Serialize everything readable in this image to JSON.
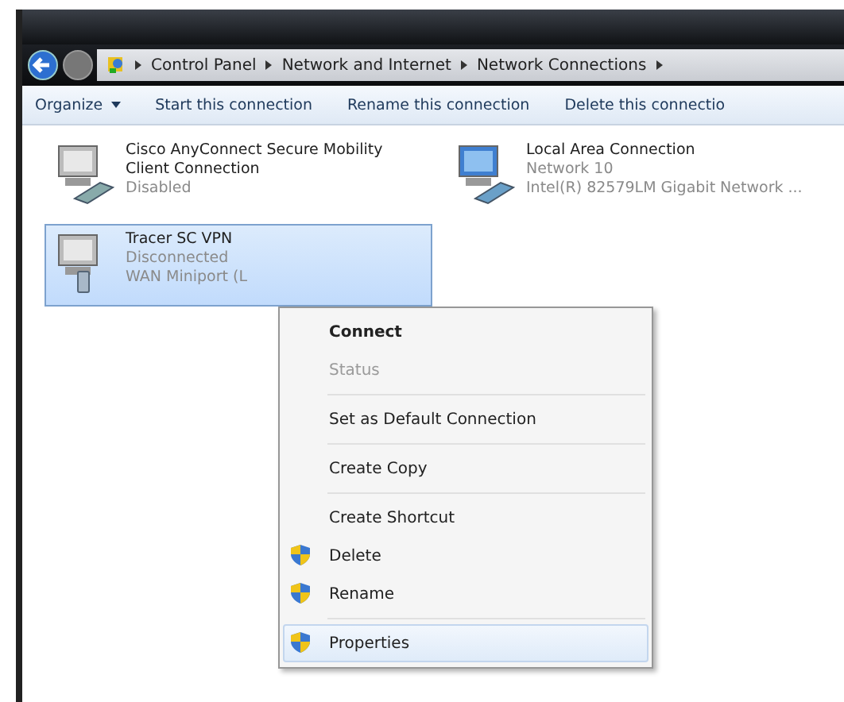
{
  "breadcrumb": [
    "Control Panel",
    "Network and Internet",
    "Network Connections"
  ],
  "toolbar": [
    {
      "label": "Organize",
      "dropdown": true
    },
    {
      "label": "Start this connection",
      "dropdown": false
    },
    {
      "label": "Rename this connection",
      "dropdown": false
    },
    {
      "label": "Delete this connectio",
      "dropdown": false
    }
  ],
  "connections": [
    {
      "name": "Cisco AnyConnect Secure Mobility Client Connection",
      "status": "Disabled",
      "selected": false,
      "kind": "cable"
    },
    {
      "name": "Local Area Connection",
      "status": "Network 10",
      "device": "Intel(R) 82579LM Gigabit Network ...",
      "selected": false,
      "kind": "network"
    },
    {
      "name": "Tracer SC VPN",
      "status": "Disconnected",
      "device": "WAN Miniport (L",
      "selected": true,
      "kind": "modem"
    }
  ],
  "context_menu": [
    {
      "kind": "item",
      "label": "Connect",
      "default": true,
      "disabled": false,
      "shield": false,
      "selected": false
    },
    {
      "kind": "item",
      "label": "Status",
      "default": false,
      "disabled": true,
      "shield": false,
      "selected": false
    },
    {
      "kind": "separator"
    },
    {
      "kind": "item",
      "label": "Set as Default Connection",
      "default": false,
      "disabled": false,
      "shield": false,
      "selected": false
    },
    {
      "kind": "separator"
    },
    {
      "kind": "item",
      "label": "Create Copy",
      "default": false,
      "disabled": false,
      "shield": false,
      "selected": false
    },
    {
      "kind": "separator"
    },
    {
      "kind": "item",
      "label": "Create Shortcut",
      "default": false,
      "disabled": false,
      "shield": false,
      "selected": false
    },
    {
      "kind": "item",
      "label": "Delete",
      "default": false,
      "disabled": false,
      "shield": true,
      "selected": false
    },
    {
      "kind": "item",
      "label": "Rename",
      "default": false,
      "disabled": false,
      "shield": true,
      "selected": false
    },
    {
      "kind": "separator"
    },
    {
      "kind": "item",
      "label": "Properties",
      "default": false,
      "disabled": false,
      "shield": true,
      "selected": true
    }
  ]
}
